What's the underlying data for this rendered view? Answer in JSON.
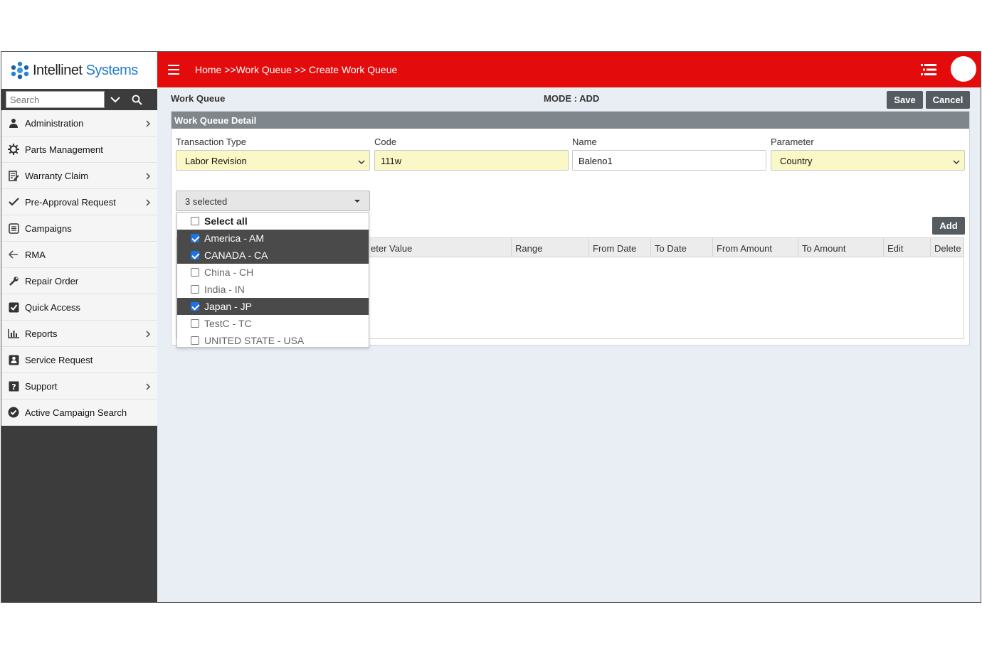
{
  "brand": {
    "name_part1": "Intellinet",
    "name_part2": "Systems"
  },
  "search": {
    "placeholder": "Search"
  },
  "menu": [
    {
      "label": "Administration",
      "icon": "user-icon",
      "has_arrow": true
    },
    {
      "label": "Parts Management",
      "icon": "gear-icon",
      "has_arrow": false
    },
    {
      "label": "Warranty Claim",
      "icon": "edit-list-icon",
      "has_arrow": true
    },
    {
      "label": "Pre-Approval Request",
      "icon": "check-icon",
      "has_arrow": true
    },
    {
      "label": "Campaigns",
      "icon": "list-box-icon",
      "has_arrow": false
    },
    {
      "label": "RMA",
      "icon": "arrow-left-icon",
      "has_arrow": false
    },
    {
      "label": "Repair Order",
      "icon": "wrench-icon",
      "has_arrow": false
    },
    {
      "label": "Quick Access",
      "icon": "checkbox-icon",
      "has_arrow": false
    },
    {
      "label": "Reports",
      "icon": "bar-chart-icon",
      "has_arrow": true
    },
    {
      "label": "Service Request",
      "icon": "person-box-icon",
      "has_arrow": false
    },
    {
      "label": "Support",
      "icon": "question-icon",
      "has_arrow": true
    },
    {
      "label": "Active Campaign Search",
      "icon": "check-circle-icon",
      "has_arrow": false
    }
  ],
  "header": {
    "breadcrumb": "Home >>Work Queue >> Create Work Queue"
  },
  "page": {
    "title": "Work Queue",
    "mode": "MODE : ADD",
    "save_label": "Save",
    "cancel_label": "Cancel",
    "add_label": "Add"
  },
  "panel": {
    "title": "Work Queue Detail",
    "transaction_type": {
      "label": "Transaction Type",
      "value": "Labor Revision"
    },
    "code": {
      "label": "Code",
      "value": "111w"
    },
    "name": {
      "label": "Name",
      "value": "Baleno1"
    },
    "parameter": {
      "label": "Parameter",
      "value": "Country"
    }
  },
  "multiselect": {
    "summary": "3 selected",
    "select_all": "Select all",
    "options": [
      {
        "label": "America - AM",
        "checked": true
      },
      {
        "label": "CANADA - CA",
        "checked": true
      },
      {
        "label": "China - CH",
        "checked": false
      },
      {
        "label": "India - IN",
        "checked": false
      },
      {
        "label": "Japan - JP",
        "checked": true
      },
      {
        "label": "TestC - TC",
        "checked": false
      },
      {
        "label": "UNITED STATE - USA",
        "checked": false
      }
    ]
  },
  "grid": {
    "columns": [
      "eter Value",
      "Range",
      "From Date",
      "To Date",
      "From Amount",
      "To Amount",
      "Edit",
      "Delete"
    ]
  },
  "colors": {
    "header_red": "#e30b0b",
    "sidebar_dark": "#3c3c3c",
    "accent_blue": "#1f7bd0",
    "field_yellow": "#fbf8c7"
  }
}
